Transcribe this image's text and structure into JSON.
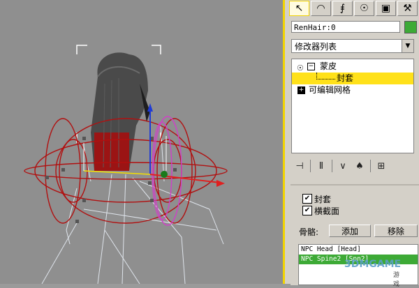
{
  "toolbar": {
    "tabs": [
      {
        "name": "create",
        "icon": "cursor-arrow-icon"
      },
      {
        "name": "modify",
        "icon": "modify-arc-icon"
      },
      {
        "name": "hierarchy",
        "icon": "hierarchy-icon"
      },
      {
        "name": "motion",
        "icon": "motion-wheel-icon"
      },
      {
        "name": "display",
        "icon": "display-monitor-icon"
      },
      {
        "name": "utilities",
        "icon": "hammer-icon"
      }
    ]
  },
  "object": {
    "name": "RenHair:0",
    "color": "#3daa36"
  },
  "modifier_list": {
    "label": "修改器列表"
  },
  "stack": {
    "items": [
      {
        "label": "蒙皮",
        "expanded": true
      },
      {
        "label": "封套",
        "selected": true
      },
      {
        "label": "可编辑网格"
      }
    ]
  },
  "stack_tools": [
    {
      "name": "pin-stack",
      "icon": "pin-icon"
    },
    {
      "name": "show-end-result",
      "icon": "show-result-icon"
    },
    {
      "name": "make-unique",
      "icon": "make-unique-icon"
    },
    {
      "name": "remove-modifier",
      "icon": "trash-icon"
    },
    {
      "name": "configure-sets",
      "icon": "configure-sets-icon"
    }
  ],
  "params": {
    "envelope_checkbox_label": "封套",
    "cross_section_checkbox_label": "横截面",
    "bones_label": "骨骼:",
    "add_button": "添加",
    "remove_button": "移除",
    "bones": [
      {
        "label": "NPC Head [Head]",
        "selected": false
      },
      {
        "label": "NPC Spine2 [Spn2]",
        "selected": true
      }
    ]
  },
  "watermark": {
    "text": "3DMGAME",
    "sub": "游戏"
  }
}
